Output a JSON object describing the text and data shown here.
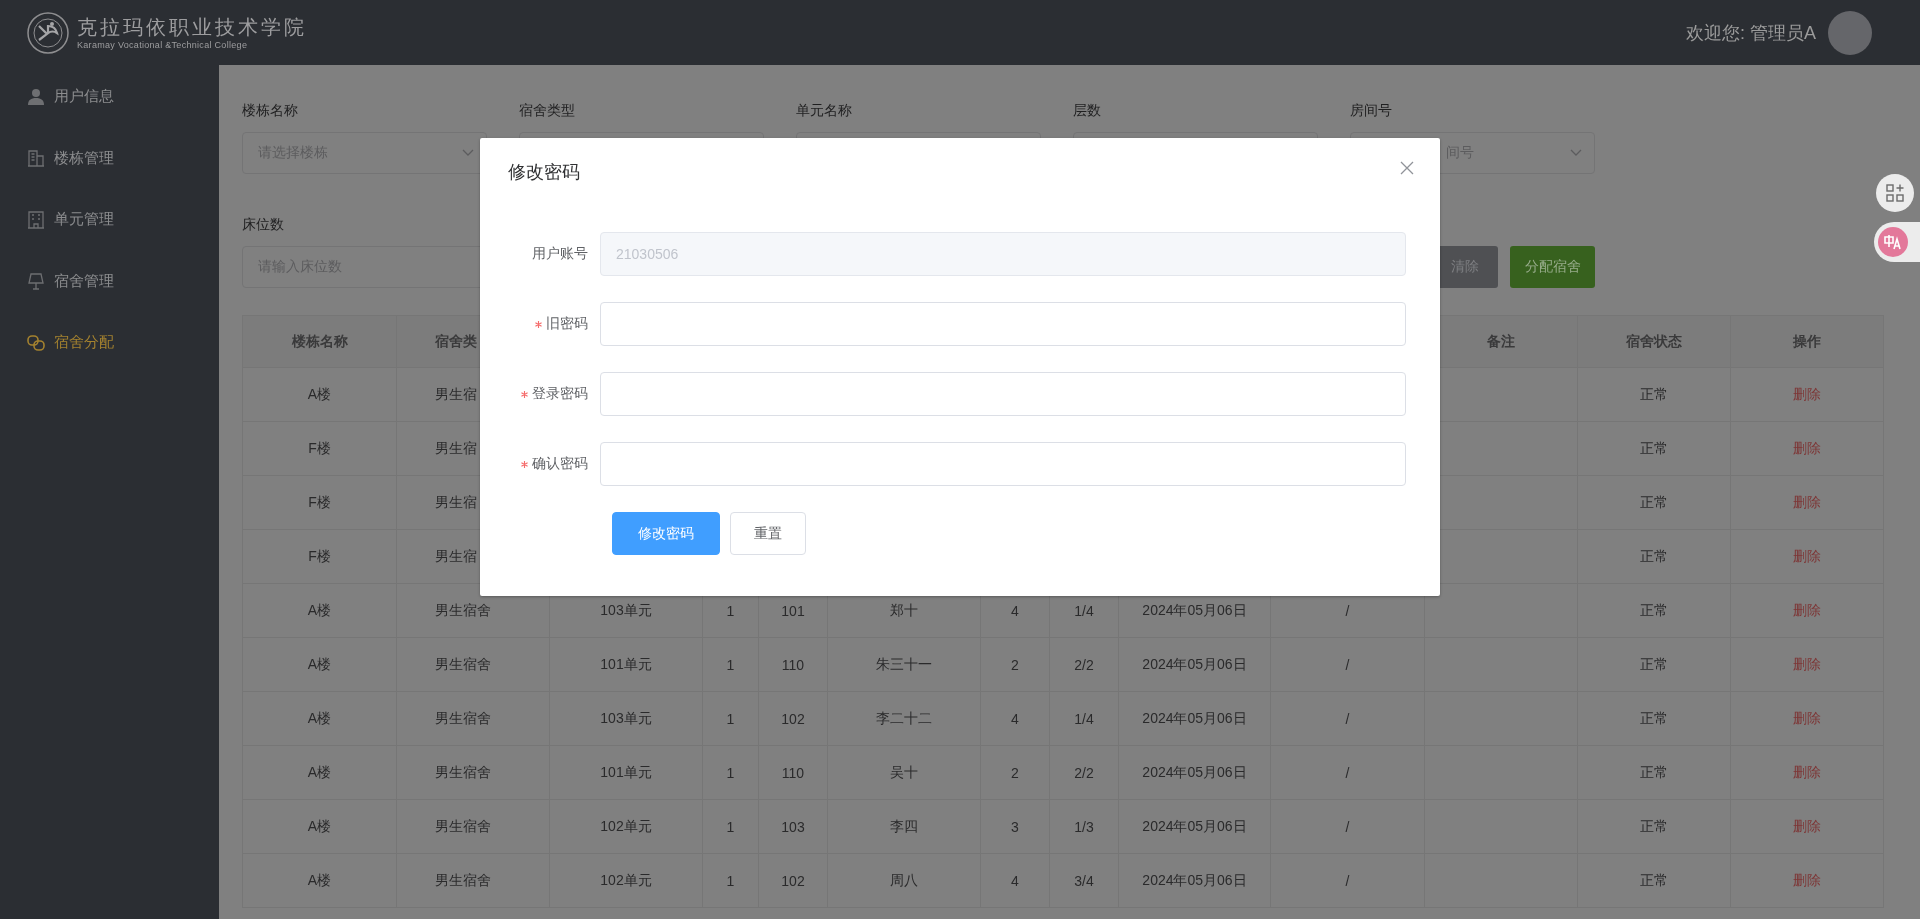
{
  "header": {
    "title": "克拉玛依职业技术学院",
    "subtitle": "Karamay Vocational &Technical College",
    "welcome": "欢迎您: 管理员A"
  },
  "sidebar": {
    "items": [
      {
        "label": "用户信息",
        "kind": "user",
        "selected": false
      },
      {
        "label": "楼栋管理",
        "kind": "building",
        "selected": false
      },
      {
        "label": "单元管理",
        "kind": "unit",
        "selected": false
      },
      {
        "label": "宿舍管理",
        "kind": "lamp",
        "selected": false
      },
      {
        "label": "宿舍分配",
        "kind": "link",
        "selected": true
      }
    ]
  },
  "filters": [
    {
      "label": "楼栋名称",
      "kind": "select",
      "placeholder": "请选择楼栋"
    },
    {
      "label": "宿舍类型",
      "kind": "select"
    },
    {
      "label": "单元名称",
      "kind": "select"
    },
    {
      "label": "层数",
      "kind": "select"
    },
    {
      "label": "房间号",
      "kind": "select",
      "placeholder": "间号"
    },
    {
      "label": "床位数",
      "kind": "input",
      "placeholder": "请输入床位数"
    }
  ],
  "buttons": [
    {
      "label": "清除",
      "kind": "clear"
    },
    {
      "label": "分配宿舍",
      "kind": "assign"
    }
  ],
  "table": {
    "columns": [
      "楼栋名称",
      "宿舍类",
      null,
      null,
      null,
      null,
      null,
      null,
      null,
      null,
      "备注",
      "宿舍状态",
      "操作"
    ],
    "rows": [
      {
        "cells": [
          "A楼",
          "男生宿",
          null,
          null,
          null,
          null,
          null,
          null,
          null,
          null,
          null,
          "正常"
        ],
        "action": "删除"
      },
      {
        "cells": [
          "F楼",
          "男生宿",
          null,
          null,
          null,
          null,
          null,
          null,
          null,
          null,
          null,
          "正常"
        ],
        "action": "删除"
      },
      {
        "cells": [
          "F楼",
          "男生宿",
          null,
          null,
          null,
          null,
          null,
          null,
          null,
          null,
          null,
          "正常"
        ],
        "action": "删除"
      },
      {
        "cells": [
          "F楼",
          "男生宿",
          null,
          null,
          null,
          null,
          null,
          null,
          null,
          null,
          null,
          "正常"
        ],
        "action": "删除"
      },
      {
        "cells": [
          "A楼",
          "男生宿舍",
          "103单元",
          "1",
          "101",
          "郑十",
          "4",
          "1/4",
          "2024年05月06日",
          "/",
          null,
          "正常"
        ],
        "action": "删除"
      },
      {
        "cells": [
          "A楼",
          "男生宿舍",
          "101单元",
          "1",
          "110",
          "朱三十一",
          "2",
          "2/2",
          "2024年05月06日",
          "/",
          null,
          "正常"
        ],
        "action": "删除"
      },
      {
        "cells": [
          "A楼",
          "男生宿舍",
          "103单元",
          "1",
          "102",
          "李二十二",
          "4",
          "1/4",
          "2024年05月06日",
          "/",
          null,
          "正常"
        ],
        "action": "删除"
      },
      {
        "cells": [
          "A楼",
          "男生宿舍",
          "101单元",
          "1",
          "110",
          "吴十",
          "2",
          "2/2",
          "2024年05月06日",
          "/",
          null,
          "正常"
        ],
        "action": "删除"
      },
      {
        "cells": [
          "A楼",
          "男生宿舍",
          "102单元",
          "1",
          "103",
          "李四",
          "3",
          "1/3",
          "2024年05月06日",
          "/",
          null,
          "正常"
        ],
        "action": "删除"
      },
      {
        "cells": [
          "A楼",
          "男生宿舍",
          "102单元",
          "1",
          "102",
          "周八",
          "4",
          "3/4",
          "2024年05月06日",
          "/",
          null,
          "正常"
        ],
        "action": "删除"
      }
    ]
  },
  "dialog": {
    "title": "修改密码",
    "fields": [
      {
        "label": "用户账号",
        "value": "21030506",
        "disabled": true,
        "required": false
      },
      {
        "label": "旧密码",
        "disabled": false,
        "required": true
      },
      {
        "label": "登录密码",
        "disabled": false,
        "required": true
      },
      {
        "label": "确认密码",
        "disabled": false,
        "required": true
      }
    ],
    "buttons": [
      {
        "label": "修改密码",
        "kind": "primary"
      },
      {
        "label": "重置",
        "kind": "default"
      }
    ]
  }
}
